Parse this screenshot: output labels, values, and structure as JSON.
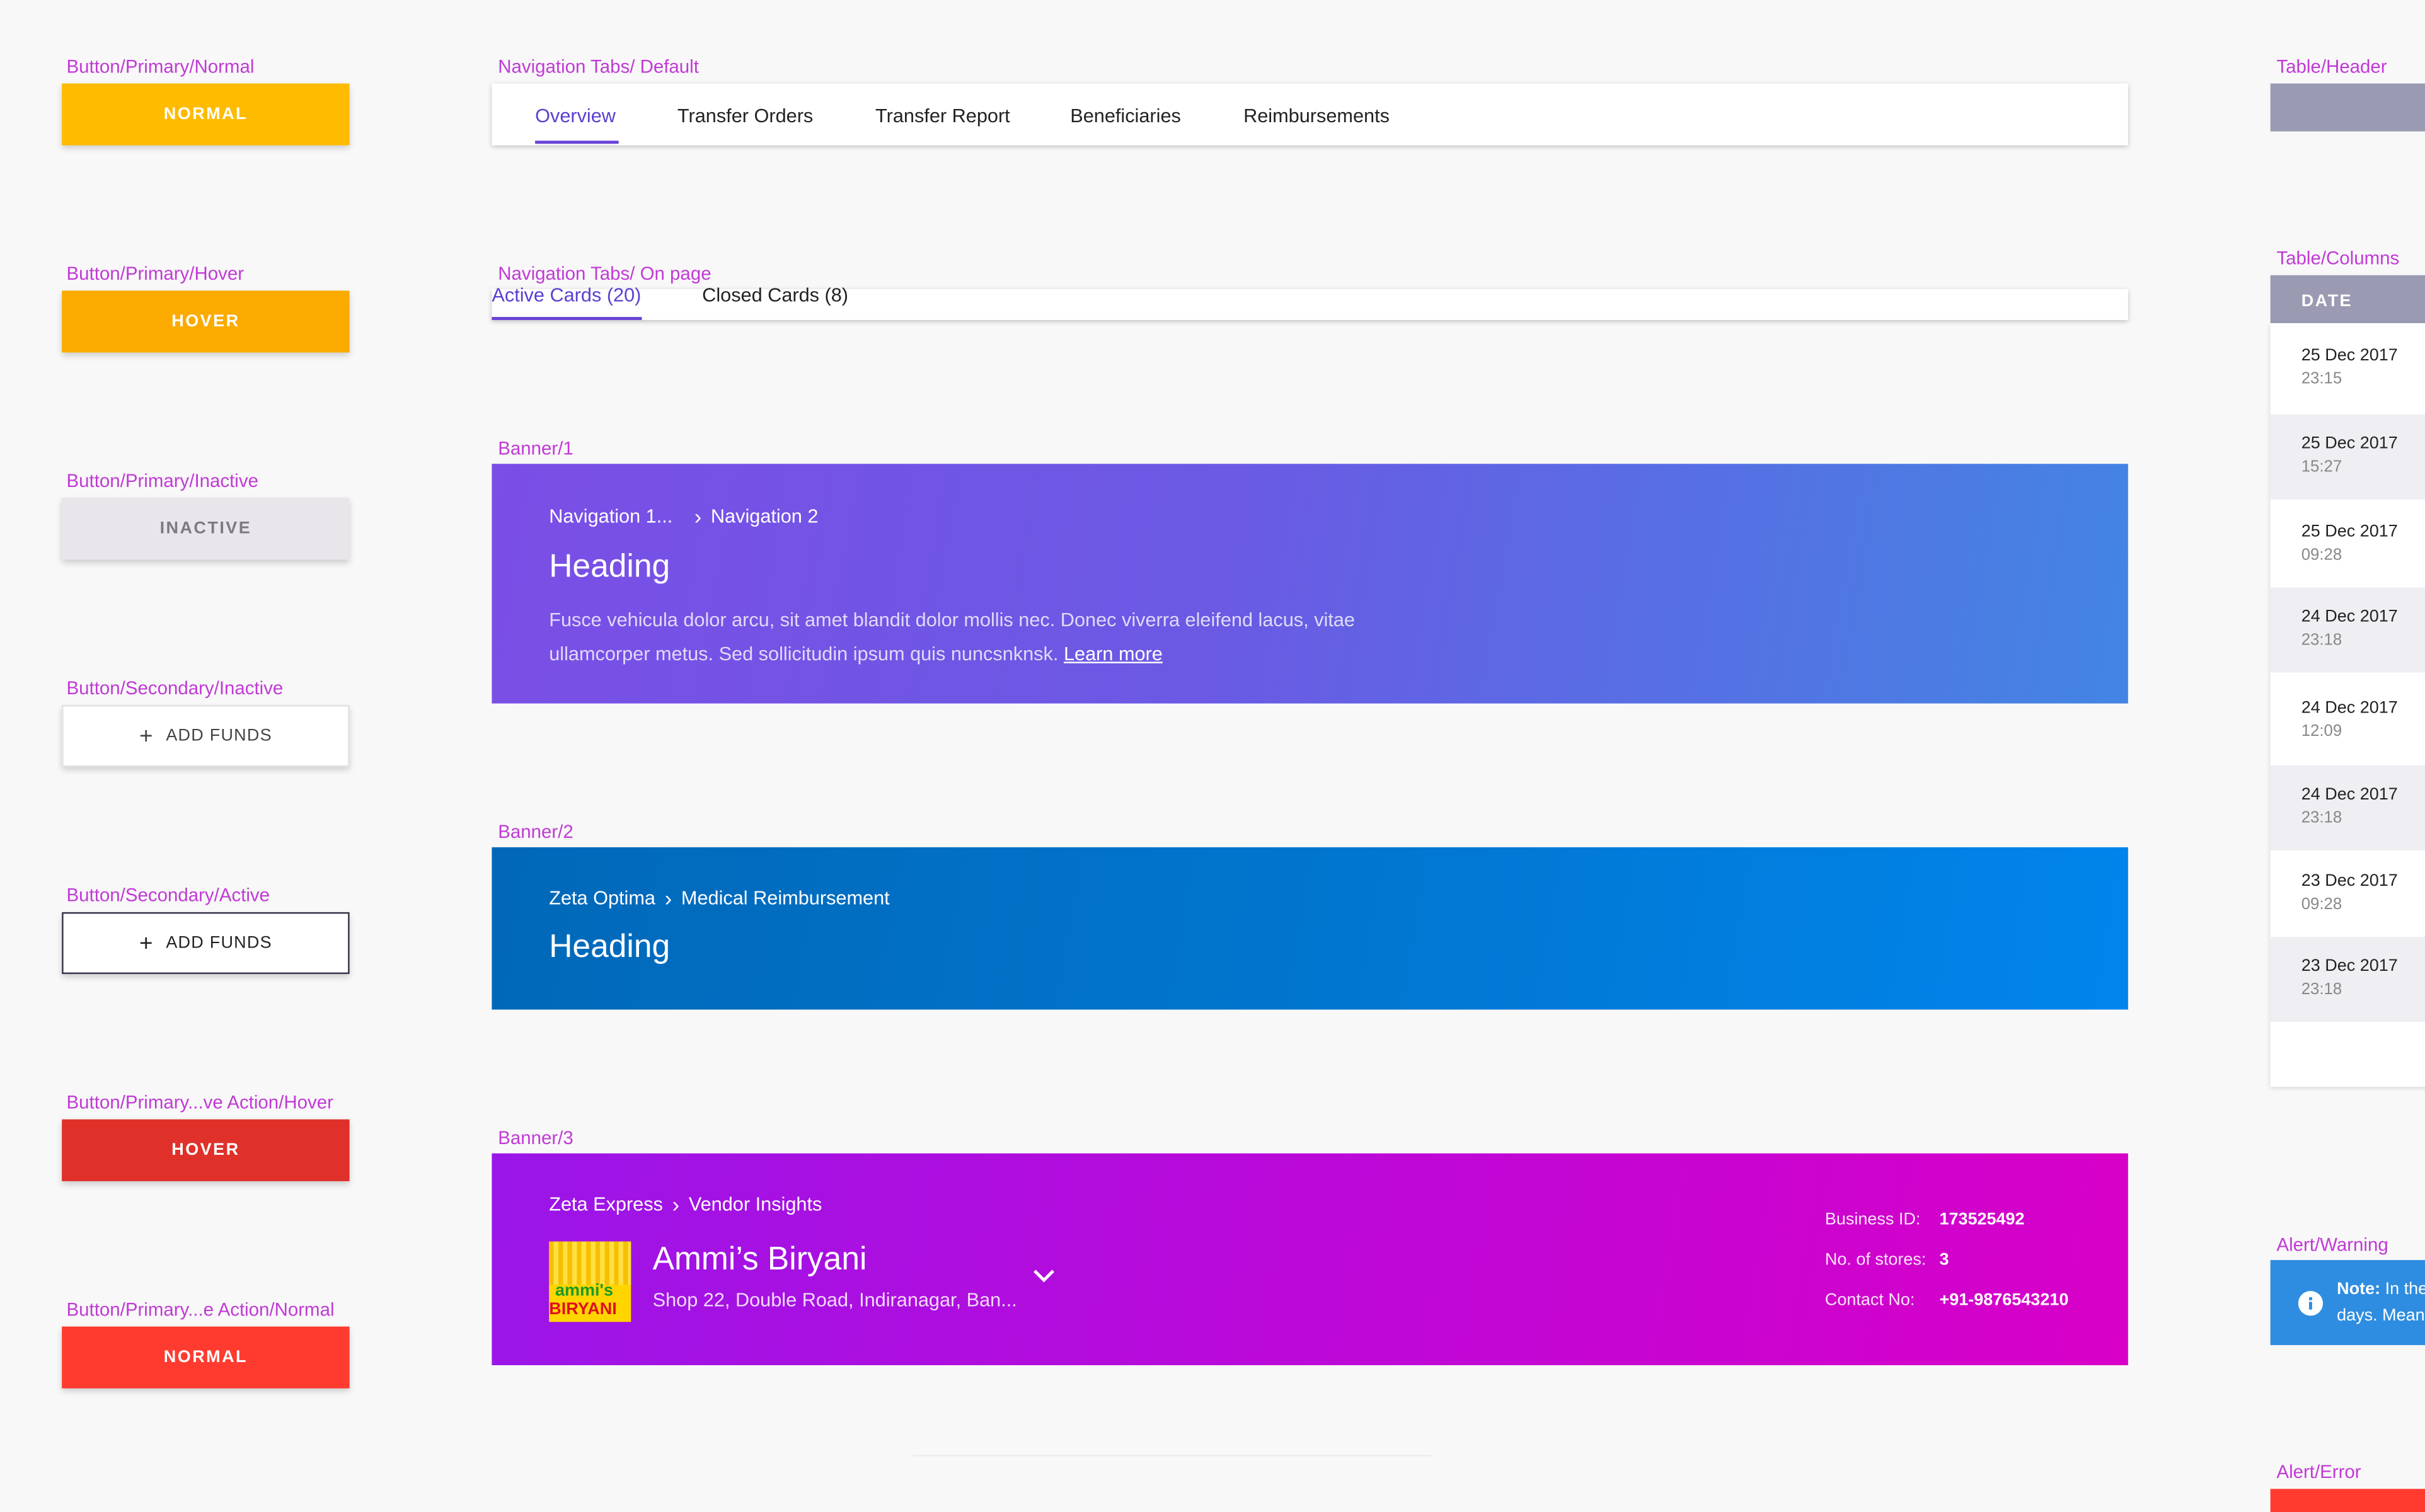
{
  "labels": {
    "btn_primary_normal": "Button/Primary/Normal",
    "btn_primary_hover": "Button/Primary/Hover",
    "btn_primary_inactive": "Button/Primary/Inactive",
    "btn_secondary_inactive": "Button/Secondary/Inactive",
    "btn_secondary_active": "Button/Secondary/Active",
    "btn_negative_hover": "Button/Primary...ve Action/Hover",
    "btn_negative_normal": "Button/Primary...e Action/Normal",
    "nav_default": "Navigation Tabs/ Default",
    "nav_onpage": "Navigation Tabs/ On page",
    "banner1": "Banner/1",
    "banner2": "Banner/2",
    "banner3": "Banner/3",
    "table_header": "Table/Header",
    "table_columns": "Table/Columns",
    "alert_warning": "Alert/Warning",
    "alert_error": "Alert/Error"
  },
  "buttons": {
    "normal": "NORMAL",
    "hover": "HOVER",
    "inactive": "INACTIVE",
    "plus": "+",
    "add_funds": "ADD FUNDS",
    "neg_hover": "HOVER",
    "neg_normal": "NORMAL"
  },
  "nav_default": {
    "tabs": [
      "Overview",
      "Transfer Orders",
      "Transfer Report",
      "Beneficiaries",
      "Reimbursements"
    ],
    "active": 0
  },
  "nav_onpage": {
    "tabs": [
      "Active Cards (20)",
      "Closed Cards (8)"
    ],
    "active": 0
  },
  "banner1": {
    "crumb1": "Navigation 1...",
    "chev": "›",
    "crumb2": "Navigation 2",
    "heading": "Heading",
    "text": "Fusce vehicula dolor arcu, sit amet blandit dolor mollis nec. Donec viverra eleifend lacus, vitae ullamcorper metus. Sed sollicitudin ipsum quis nuncsnknsk.",
    "link": "Learn more"
  },
  "banner2": {
    "crumb1": "Zeta Optima",
    "chev": "›",
    "crumb2": "Medical Reimbursement",
    "heading": "Heading"
  },
  "banner3": {
    "crumb1": "Zeta Express",
    "chev": "›",
    "crumb2": "Vendor Insights",
    "logo_top": "ammi's",
    "logo_bottom": "BIRYANI",
    "name": "Ammi’s Biryani",
    "address": "Shop 22, Double Road, Indiranagar, Ban...",
    "business_id_label": "Business ID:",
    "business_id": "173525492",
    "stores_label": "No. of stores:",
    "stores": "3",
    "contact_label": "Contact No:",
    "contact": "+91-9876543210"
  },
  "table": {
    "column_header": "DATE",
    "rows": [
      {
        "date": "25 Dec 2017",
        "time": "23:15"
      },
      {
        "date": "25 Dec 2017",
        "time": "15:27"
      },
      {
        "date": "25 Dec 2017",
        "time": "09:28"
      },
      {
        "date": "24 Dec 2017",
        "time": "23:18"
      },
      {
        "date": "24 Dec 2017",
        "time": "12:09"
      },
      {
        "date": "24 Dec 2017",
        "time": "23:18"
      },
      {
        "date": "23 Dec 2017",
        "time": "09:28"
      },
      {
        "date": "23 Dec 2017",
        "time": "23:18"
      }
    ]
  },
  "alert_warning": {
    "note": "Note:",
    "text1": "In the",
    "text2": "days. Mean"
  },
  "colors": {
    "label": "#c13ad6",
    "primary_normal": "#ffbb00",
    "primary_hover": "#fbab00",
    "inactive": "#e8e6ea",
    "negative_hover": "#e0302a",
    "negative_normal": "#ff3b30",
    "tab_accent": "#6a43d6",
    "table_header": "#9a9ab3",
    "alert_info": "#2e8de0"
  }
}
